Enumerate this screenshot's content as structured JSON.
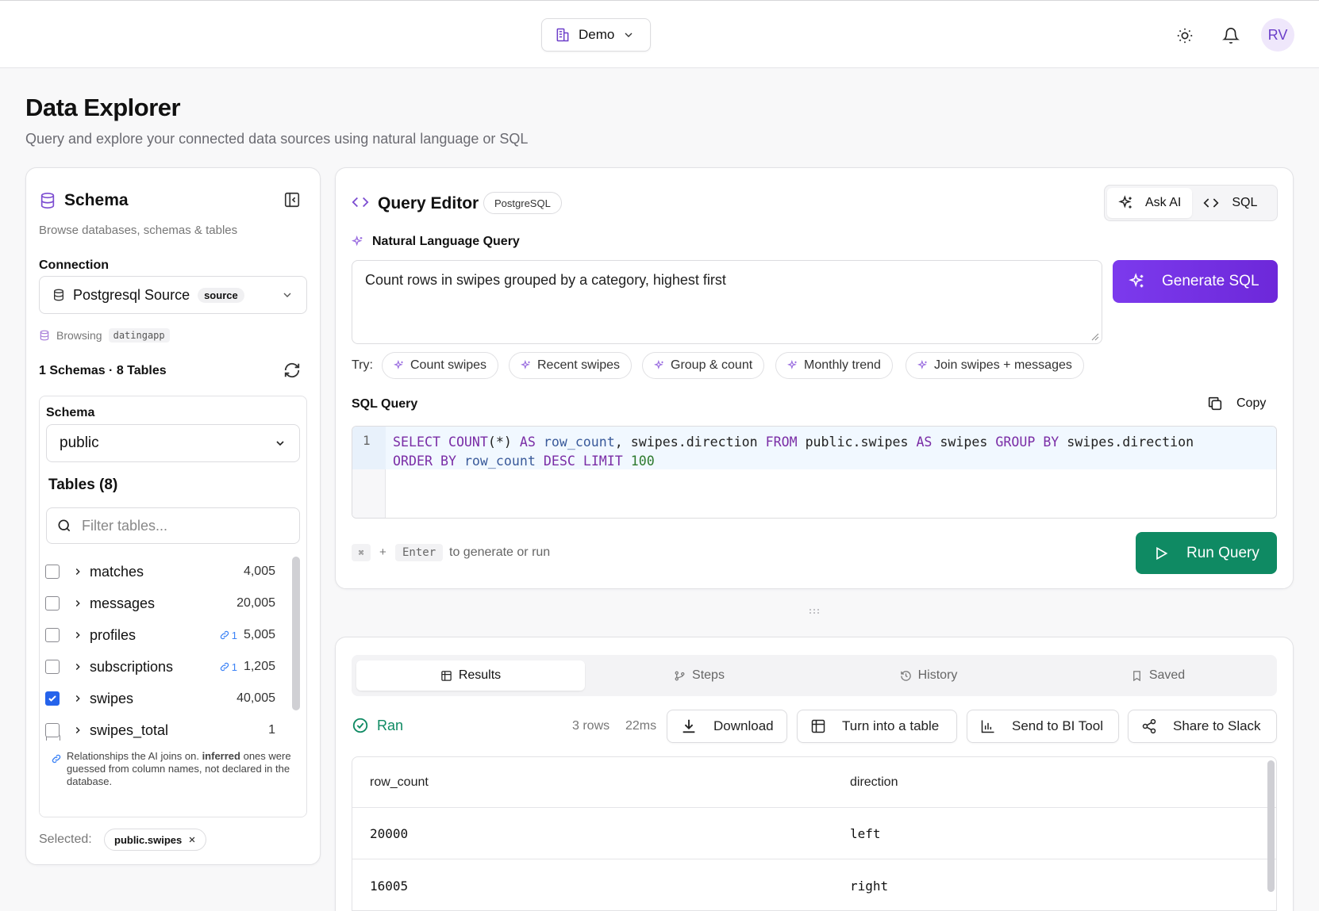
{
  "topbar": {
    "workspace": "Demo",
    "avatar_initials": "RV"
  },
  "page": {
    "title": "Data Explorer",
    "subtitle": "Query and explore your connected data sources using natural language or SQL"
  },
  "schema_panel": {
    "title": "Schema",
    "subtitle": "Browse databases, schemas & tables",
    "connection_label": "Connection",
    "connection_value": "Postgresql Source",
    "connection_badge": "source",
    "browsing_label": "Browsing",
    "browsing_db": "datingapp",
    "summary": "1 Schemas · 8 Tables",
    "schema_label": "Schema",
    "schema_value": "public",
    "tables_title": "Tables (8)",
    "filter_placeholder": "Filter tables...",
    "tables": [
      {
        "name": "matches",
        "count": "4,005",
        "rel": "",
        "checked": false
      },
      {
        "name": "messages",
        "count": "20,005",
        "rel": "",
        "checked": false
      },
      {
        "name": "profiles",
        "count": "5,005",
        "rel": "1",
        "checked": false
      },
      {
        "name": "subscriptions",
        "count": "1,205",
        "rel": "1",
        "checked": false
      },
      {
        "name": "swipes",
        "count": "40,005",
        "rel": "",
        "checked": true
      },
      {
        "name": "swipes_total",
        "count": "1",
        "rel": "",
        "checked": false
      }
    ],
    "note_pre": "Relationships the AI joins on.",
    "note_bold": "inferred",
    "note_post": "ones were guessed from column names, not declared in the database.",
    "selected_label": "Selected:",
    "selected_value": "public.swipes"
  },
  "editor": {
    "title": "Query Editor",
    "dialect": "PostgreSQL",
    "mode_ai": "Ask AI",
    "mode_sql": "SQL",
    "nl_label": "Natural Language Query",
    "nl_value": "Count rows in swipes grouped by a category, highest first",
    "generate_label": "Generate SQL",
    "try_label": "Try:",
    "suggestions": [
      "Count swipes",
      "Recent swipes",
      "Group & count",
      "Monthly trend",
      "Join swipes + messages"
    ],
    "sql_label": "SQL Query",
    "copy_label": "Copy",
    "line_number": "1",
    "sql_line1": "SELECT COUNT(*) AS row_count, swipes.direction FROM public.swipes AS swipes GROUP BY swipes.direction",
    "sql_line2": "ORDER BY row_count DESC LIMIT 100",
    "shortcut_key1": "⌘",
    "shortcut_plus": "+",
    "shortcut_key2": "Enter",
    "shortcut_hint": "to generate or run",
    "run_label": "Run Query"
  },
  "results": {
    "tabs": [
      "Results",
      "Steps",
      "History",
      "Saved"
    ],
    "status": "Ran",
    "rows_info": "3 rows",
    "time_info": "22ms",
    "actions": [
      "Download",
      "Turn into a table",
      "Send to BI Tool",
      "Share to Slack"
    ],
    "columns": [
      "row_count",
      "direction"
    ],
    "rows": [
      [
        "20000",
        "left"
      ],
      [
        "16005",
        "right"
      ]
    ]
  },
  "colors": {
    "accent_purple": "#6d28d9",
    "run_green": "#0f8a63",
    "checkbox_blue": "#2563eb"
  }
}
